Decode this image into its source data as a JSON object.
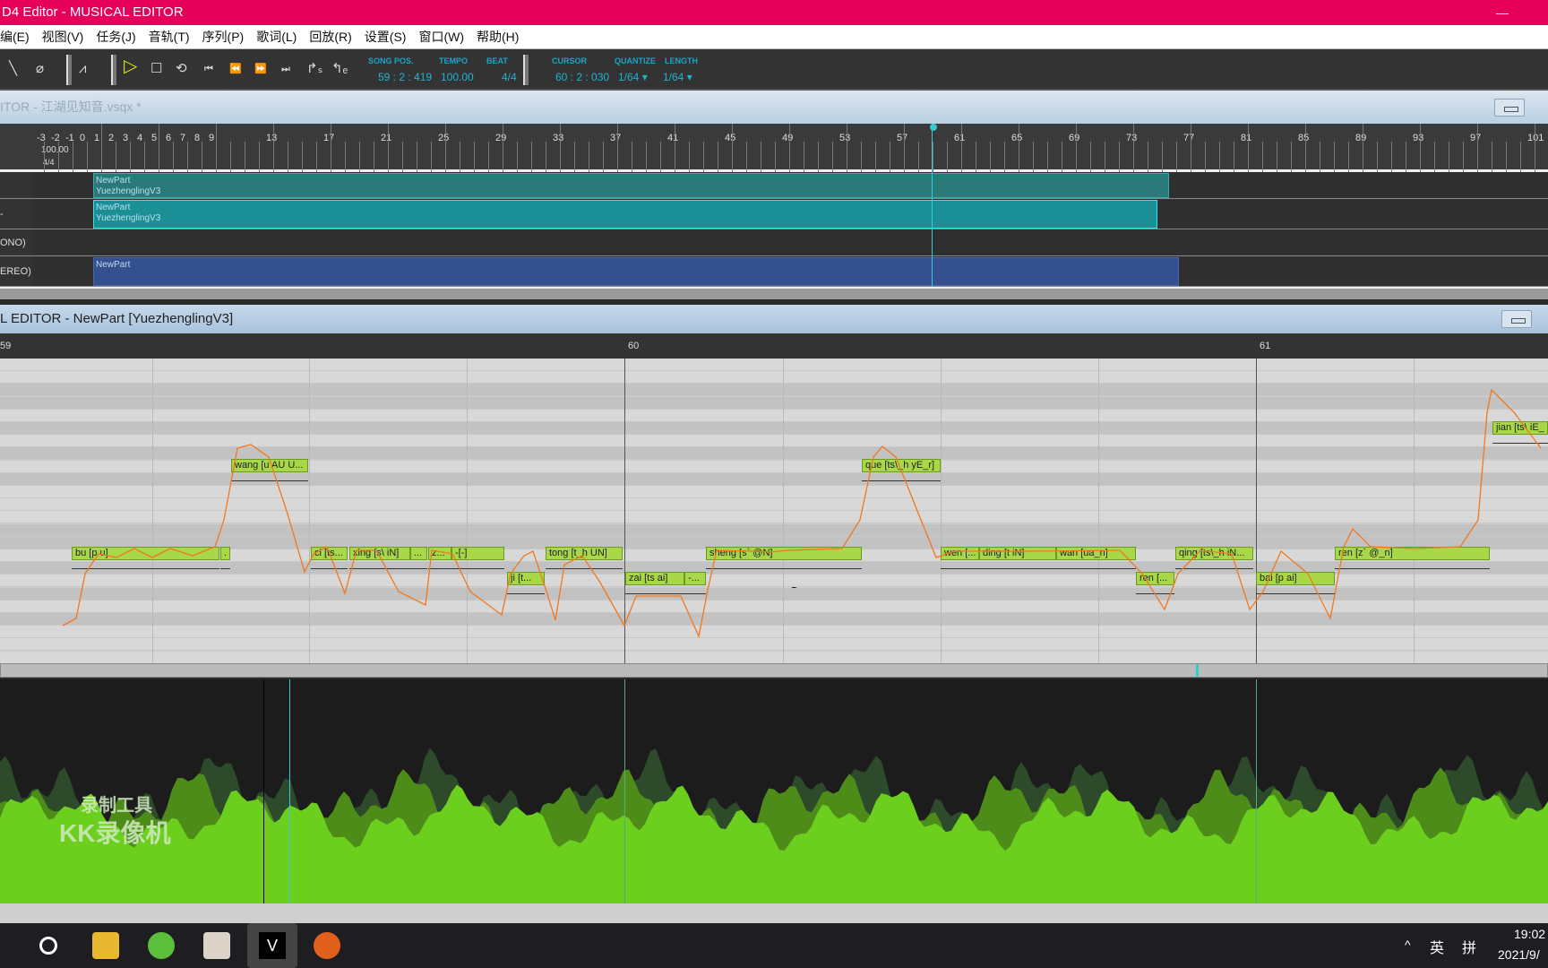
{
  "window": {
    "title": "D4 Editor - MUSICAL EDITOR"
  },
  "menu": [
    "编(E)",
    "视图(V)",
    "任务(J)",
    "音轨(T)",
    "序列(P)",
    "歌词(L)",
    "回放(R)",
    "设置(S)",
    "窗口(W)",
    "帮助(H)"
  ],
  "toolbar": {
    "song_pos_label": "SONG POS.",
    "song_pos": "59 : 2 : 419",
    "tempo_label": "TEMPO",
    "tempo": "100.00",
    "beat_label": "BEAT",
    "beat": "4/4",
    "cursor_label": "CURSOR",
    "cursor": "60 : 2 : 030",
    "quantize_label": "QUANTIZE",
    "quantize": "1/64 ▾",
    "length_label": "LENGTH",
    "length": "1/64 ▾",
    "accent": "#1fb3d0"
  },
  "track_editor": {
    "title": "ITOR - 江湖见知音.vsqx *",
    "ruler": [
      "-3",
      "-2",
      "-1",
      "0",
      "1",
      "2",
      "3",
      "4",
      "5",
      "6",
      "7",
      "8",
      "9",
      "13",
      "17",
      "21",
      "25",
      "29",
      "33",
      "37",
      "41",
      "45",
      "49",
      "53",
      "57",
      "61",
      "65",
      "69",
      "73",
      "77",
      "81",
      "85",
      "89",
      "93",
      "97",
      "101"
    ],
    "ruler_tempo": "100.00",
    "ruler_sig": "4/4",
    "tracks": [
      {
        "label": "",
        "part_name": "NewPart",
        "singer": "YuezhenglingV3"
      },
      {
        "label": "-",
        "part_name": "NewPart",
        "singer": "YuezhenglingV3"
      },
      {
        "label": "ONO)"
      },
      {
        "label": "EREO)",
        "part_name": "NewPart"
      }
    ]
  },
  "musical_editor": {
    "title": "L EDITOR - NewPart [YuezhenglingV3]",
    "ruler": [
      "59",
      "60",
      "61"
    ],
    "notes": [
      {
        "lyric": "bu [p u]"
      },
      {
        "lyric": "."
      },
      {
        "lyric": "wang [u AU U..."
      },
      {
        "lyric": "ci [ts..."
      },
      {
        "lyric": "xing [s\\ iN]"
      },
      {
        "lyric": "..."
      },
      {
        "lyric": "z..."
      },
      {
        "lyric": "-[-]"
      },
      {
        "lyric": "ji [t..."
      },
      {
        "lyric": "tong [t_h UN]"
      },
      {
        "lyric": "zai [ts ai]"
      },
      {
        "lyric": "-..."
      },
      {
        "lyric": "sheng [s` @N]"
      },
      {
        "lyric": "que [ts\\_h yE_r]"
      },
      {
        "lyric": "wen [..."
      },
      {
        "lyric": "ding [t iN]"
      },
      {
        "lyric": "wan [ua_n]"
      },
      {
        "lyric": "ren [..."
      },
      {
        "lyric": "qing [ts\\_h iN..."
      },
      {
        "lyric": "bai [p ai]"
      },
      {
        "lyric": "ren [z` @_n]"
      },
      {
        "lyric": "jian [ts\\ iE_"
      }
    ],
    "note_color": "#a8d848",
    "pitch_color": "#f07820"
  },
  "watermark": {
    "line1": "录制工具",
    "line2": "KK录像机"
  },
  "taskbar": {
    "ime1": "英",
    "ime2": "拼",
    "time": "19:02",
    "date": "2021/9/",
    "tray": "^"
  }
}
